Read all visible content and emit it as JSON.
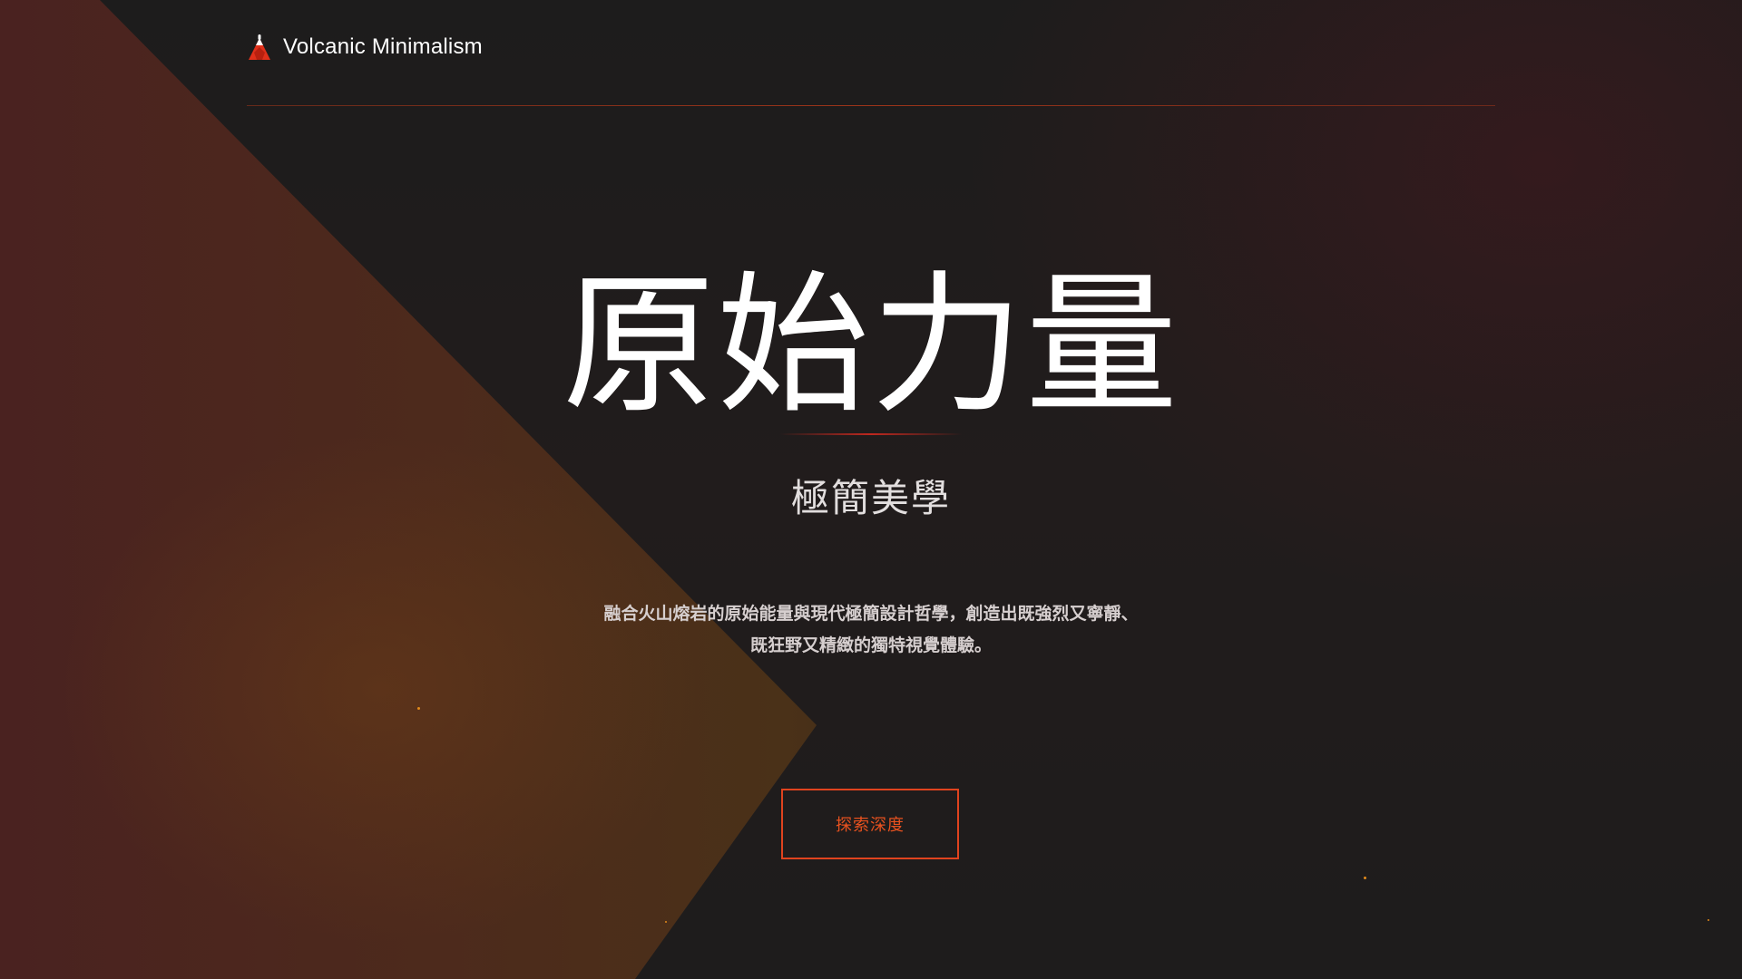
{
  "header": {
    "brand": "Volcanic Minimalism",
    "logo_icon": "volcano-icon"
  },
  "hero": {
    "title": "原始力量",
    "subtitle": "極簡美學",
    "description_line1": "融合火山熔岩的原始能量與現代極簡設計哲學，創造出既強烈又寧靜、",
    "description_line2": "既狂野又精緻的獨特視覺體驗。"
  },
  "cta": {
    "label": "探索深度"
  },
  "colors": {
    "accent": "#e0431e",
    "background": "#1c1a1a",
    "text": "#ffffff"
  }
}
